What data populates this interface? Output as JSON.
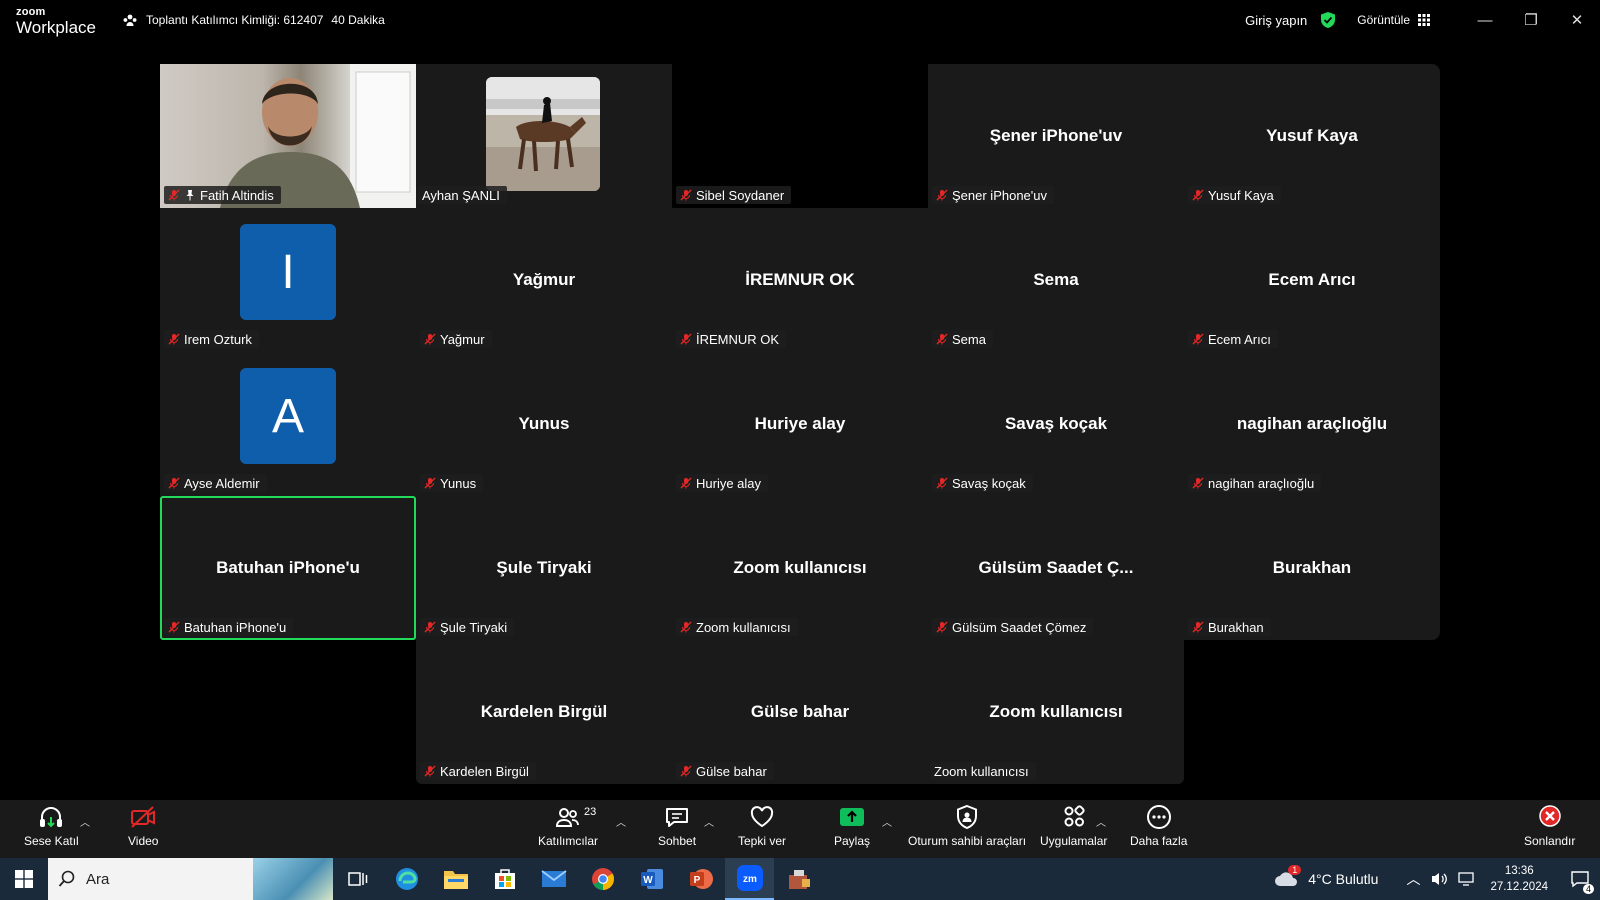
{
  "app": {
    "logo_line1": "zoom",
    "logo_line2": "Workplace"
  },
  "meeting": {
    "id_label": "Toplantı Katılımcı Kimliği: 612407",
    "duration": "40 Dakika"
  },
  "header": {
    "signin": "Giriş yapın",
    "view": "Görüntüle"
  },
  "colors": {
    "active_border": "#23d959",
    "avatar_bg": "#0e5eab",
    "tile_bg": "#1a1a1a",
    "security_green": "#23d959",
    "share_green": "#0fbd5b",
    "end_red": "#e02828"
  },
  "tiles": [
    {
      "label": "Fatih Altindis",
      "center": ""
    },
    {
      "label": "Ayhan ŞANLI",
      "center": ""
    },
    {
      "label": "Sibel Soydaner",
      "center": ""
    },
    {
      "label": "Şener iPhone'uv",
      "center": "Şener iPhone'uv"
    },
    {
      "label": "Yusuf Kaya",
      "center": "Yusuf Kaya"
    },
    {
      "label": "Irem Ozturk",
      "center": "",
      "avatar": "I"
    },
    {
      "label": "Yağmur",
      "center": "Yağmur"
    },
    {
      "label": "İREMNUR OK",
      "center": "İREMNUR OK"
    },
    {
      "label": "Sema",
      "center": "Sema"
    },
    {
      "label": "Ecem Arıcı",
      "center": "Ecem Arıcı"
    },
    {
      "label": "Ayse Aldemir",
      "center": "",
      "avatar": "A"
    },
    {
      "label": "Yunus",
      "center": "Yunus"
    },
    {
      "label": "Huriye alay",
      "center": "Huriye alay"
    },
    {
      "label": "Savaş koçak",
      "center": "Savaş koçak"
    },
    {
      "label": "nagihan araçlıoğlu",
      "center": "nagihan araçlıoğlu"
    },
    {
      "label": "Batuhan iPhone'u",
      "center": "Batuhan iPhone'u"
    },
    {
      "label": "Şule Tiryaki",
      "center": "Şule Tiryaki"
    },
    {
      "label": "Zoom kullanıcısı",
      "center": "Zoom kullanıcısı"
    },
    {
      "label": "Gülsüm Saadet Çömez",
      "center": "Gülsüm Saadet Ç..."
    },
    {
      "label": "Burakhan",
      "center": "Burakhan"
    },
    {
      "label": "Kardelen Birgül",
      "center": "Kardelen Birgül"
    },
    {
      "label": "Gülse bahar",
      "center": "Gülse bahar"
    },
    {
      "label": "Zoom kullanıcısı",
      "center": "Zoom kullanıcısı"
    }
  ],
  "toolbar": {
    "audio": "Sese Katıl",
    "video": "Video",
    "participants": "Katılımcılar",
    "participants_count": "23",
    "chat": "Sohbet",
    "react": "Tepki ver",
    "share": "Paylaş",
    "host_tools": "Oturum sahibi araçları",
    "apps": "Uygulamalar",
    "more": "Daha fazla",
    "end": "Sonlandır"
  },
  "taskbar": {
    "search_placeholder": "Ara",
    "weather": "4°C  Bulutlu",
    "weather_badge": "1",
    "time": "13:36",
    "date": "27.12.2024",
    "notification_count": "4"
  }
}
